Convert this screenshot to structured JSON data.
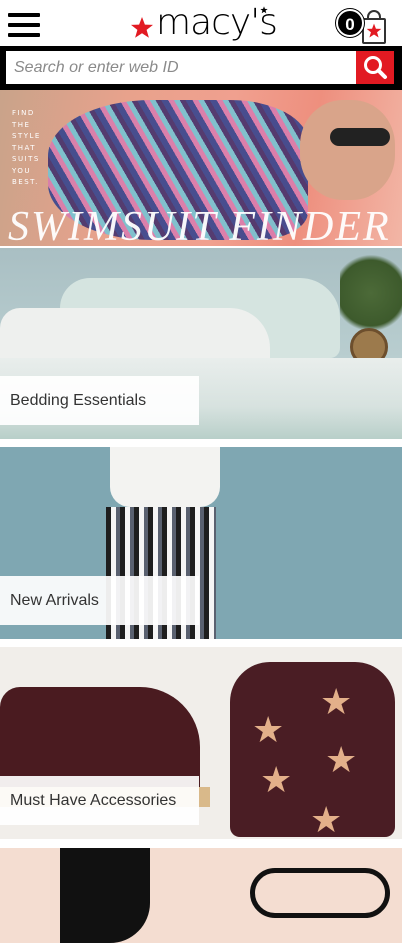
{
  "header": {
    "logo_text": "macy's",
    "menu_icon": "hamburger-menu-icon",
    "bag_count": "0",
    "bag_icon": "shopping-bag-icon",
    "brand_color": "#e21a22"
  },
  "search": {
    "placeholder": "Search or enter web ID",
    "value": "",
    "button_icon": "search-icon"
  },
  "banners": [
    {
      "name": "swimsuit-finder",
      "tagline": [
        "FIND",
        "THE",
        "STYLE",
        "THAT",
        "SUITS",
        "YOU",
        "BEST."
      ],
      "title": "SWIMSUIT FINDER"
    },
    {
      "name": "bedding-essentials",
      "label": "Bedding Essentials"
    },
    {
      "name": "new-arrivals",
      "label": "New Arrivals"
    },
    {
      "name": "must-have-accessories",
      "label": "Must Have Accessories"
    },
    {
      "name": "shoes",
      "label": ""
    }
  ]
}
